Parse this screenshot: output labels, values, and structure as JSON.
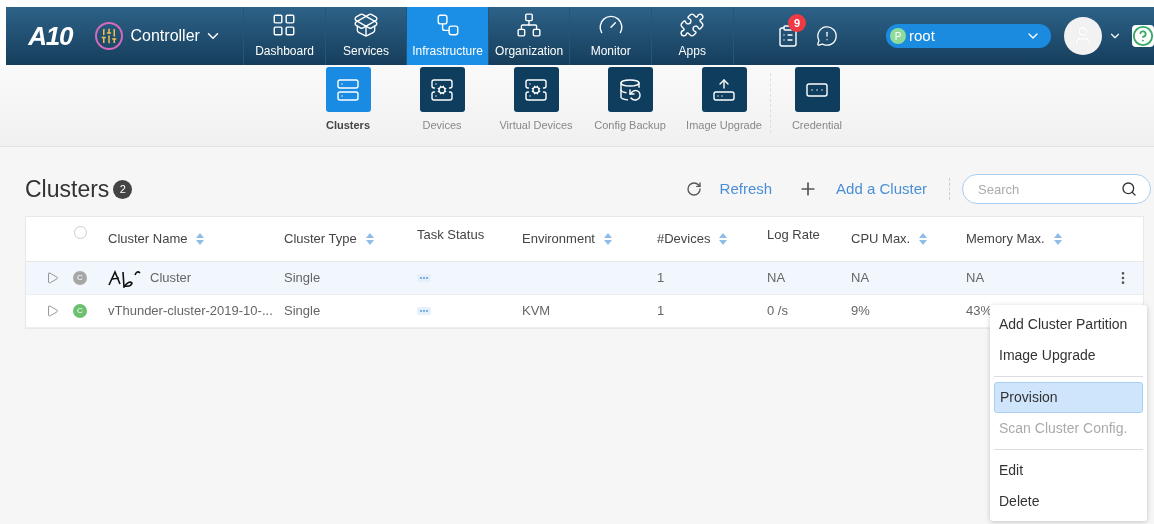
{
  "logo": "A10",
  "product": {
    "label": "Controller"
  },
  "nav": [
    {
      "label": "Dashboard",
      "selected": false
    },
    {
      "label": "Services",
      "selected": false
    },
    {
      "label": "Infrastructure",
      "selected": true
    },
    {
      "label": "Organization",
      "selected": false
    },
    {
      "label": "Monitor",
      "selected": false
    },
    {
      "label": "Apps",
      "selected": false
    }
  ],
  "notifications": {
    "count": "9"
  },
  "provider": {
    "badge": "P",
    "value": "root"
  },
  "subnav": [
    {
      "label": "Clusters",
      "selected": true
    },
    {
      "label": "Devices",
      "selected": false
    },
    {
      "label": "Virtual Devices",
      "selected": false
    },
    {
      "label": "Config Backup",
      "selected": false
    },
    {
      "label": "Image Upgrade",
      "selected": false
    },
    {
      "label": "Credential",
      "selected": false
    }
  ],
  "page": {
    "title": "Clusters",
    "count": "2"
  },
  "actions": [
    {
      "label": "Refresh"
    },
    {
      "label": "Add a Cluster"
    }
  ],
  "search": {
    "placeholder": "Search"
  },
  "table": {
    "select_all": {
      "checked": false
    },
    "columns": [
      {
        "label": "Cluster Name",
        "sortable": true
      },
      {
        "label": "Cluster Type",
        "sortable": true
      },
      {
        "label": "Task Status",
        "sortable": false
      },
      {
        "label": "Environment",
        "sortable": true
      },
      {
        "label": "#Devices",
        "sortable": true
      },
      {
        "label": "Log Rate",
        "sortable": false
      },
      {
        "label": "CPU Max.",
        "sortable": true
      },
      {
        "label": "Memory Max.",
        "sortable": true
      }
    ],
    "rows": [
      {
        "status": "C",
        "color": "#a6a6a6",
        "scribble": true,
        "selected": true,
        "cells": [
          "Cluster",
          "Single",
          "",
          "",
          "1",
          "NA",
          "NA",
          "NA"
        ]
      },
      {
        "status": "C",
        "color": "#6cc070",
        "scribble": false,
        "selected": false,
        "cells": [
          "vThunder-cluster-2019-10-...",
          "Single",
          "",
          "KVM",
          "1",
          "0 /s",
          "9%",
          "43%"
        ]
      }
    ]
  },
  "menu": {
    "groups": [
      [
        {
          "label": "Add Cluster Partition",
          "selected": false,
          "disabled": false
        },
        {
          "label": "Image Upgrade",
          "selected": false,
          "disabled": false
        }
      ],
      [
        {
          "label": "Provision",
          "selected": true,
          "disabled": false
        },
        {
          "label": "Scan Cluster Config.",
          "selected": false,
          "disabled": true
        }
      ],
      [
        {
          "label": "Edit",
          "selected": false,
          "disabled": false
        },
        {
          "label": "Delete",
          "selected": false,
          "disabled": false
        }
      ]
    ]
  }
}
